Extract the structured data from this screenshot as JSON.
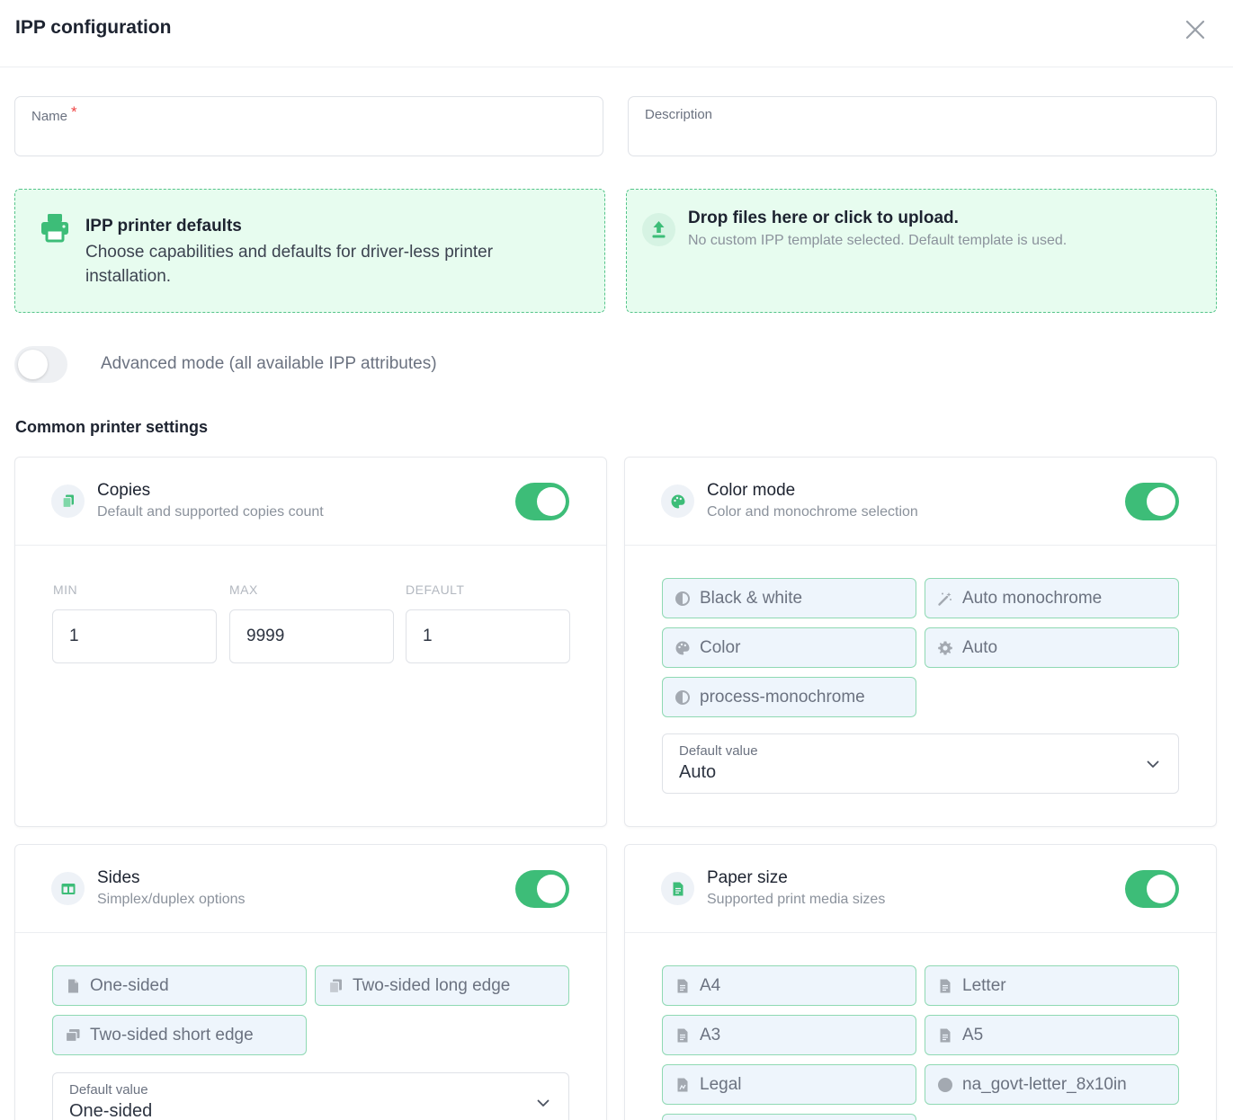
{
  "dialog": {
    "title": "IPP configuration"
  },
  "form": {
    "name_label": "Name",
    "name_required": "*",
    "name_value": "",
    "description_label": "Description",
    "description_value": ""
  },
  "defaults_box": {
    "title": "IPP printer defaults",
    "description": "Choose capabilities and defaults for driver-less printer installation."
  },
  "upload_box": {
    "title": "Drop files here or click to upload.",
    "subtitle": "No custom IPP template selected. Default template is used."
  },
  "advanced_mode": {
    "label": "Advanced mode (all available IPP attributes)",
    "enabled": false
  },
  "section_title": "Common printer settings",
  "copies": {
    "title": "Copies",
    "subtitle": "Default and supported copies count",
    "enabled": true,
    "min_label": "MIN",
    "max_label": "MAX",
    "default_label": "DEFAULT",
    "min": "1",
    "max": "9999",
    "default": "1"
  },
  "color_mode": {
    "title": "Color mode",
    "subtitle": "Color and monochrome selection",
    "enabled": true,
    "options": [
      {
        "label": "Black & white",
        "icon": "half-circle-icon"
      },
      {
        "label": "Auto monochrome",
        "icon": "magic-wand-icon"
      },
      {
        "label": "Color",
        "icon": "palette-icon"
      },
      {
        "label": "Auto",
        "icon": "gear-icon"
      },
      {
        "label": "process-monochrome",
        "icon": "half-circle-icon"
      }
    ],
    "default_label": "Default value",
    "default_value": "Auto"
  },
  "sides": {
    "title": "Sides",
    "subtitle": "Simplex/duplex options",
    "enabled": true,
    "options": [
      {
        "label": "One-sided",
        "icon": "file-icon"
      },
      {
        "label": "Two-sided long edge",
        "icon": "copy-icon"
      },
      {
        "label": "Two-sided short edge",
        "icon": "copy-icon"
      }
    ],
    "default_label": "Default value",
    "default_value": "One-sided"
  },
  "paper_size": {
    "title": "Paper size",
    "subtitle": "Supported print media sizes",
    "enabled": true,
    "options": [
      {
        "label": "A4",
        "icon": "document-icon"
      },
      {
        "label": "Letter",
        "icon": "document-icon"
      },
      {
        "label": "A3",
        "icon": "document-icon"
      },
      {
        "label": "A5",
        "icon": "document-icon"
      },
      {
        "label": "Legal",
        "icon": "legal-document-icon"
      },
      {
        "label": "na_govt-letter_8x10in",
        "icon": "dot-icon"
      }
    ]
  },
  "colors": {
    "accent": "#3dbd78",
    "chip_border": "#8fd9b3",
    "chip_bg": "#eef5fc",
    "box_bg": "#e7fcef",
    "required": "#ef4444"
  }
}
